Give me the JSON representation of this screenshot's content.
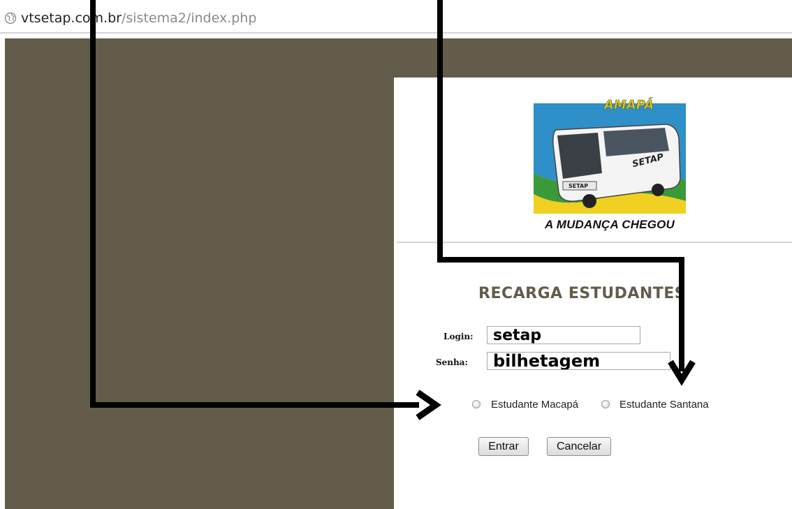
{
  "browser": {
    "url_domain": "vtsetap.com.br",
    "url_path": "/sistema2/index.php"
  },
  "logo": {
    "heading": "AMAPÁ",
    "bus_brand": "SETAP",
    "bus_plate": "SETAP",
    "caption": "A MUDANÇA CHEGOU"
  },
  "form": {
    "title": "RECARGA ESTUDANTES",
    "login_label": "Login:",
    "login_value": "setap",
    "password_label": "Senha:",
    "password_value": "bilhetagem",
    "options": [
      {
        "label": "Estudante Macapá",
        "selected": false
      },
      {
        "label": "Estudante Santana",
        "selected": false
      }
    ],
    "submit_label": "Entrar",
    "cancel_label": "Cancelar"
  },
  "colors": {
    "page_background": "#635c4a",
    "title_color": "#635c4a",
    "annotation_arrow": "#000000"
  }
}
